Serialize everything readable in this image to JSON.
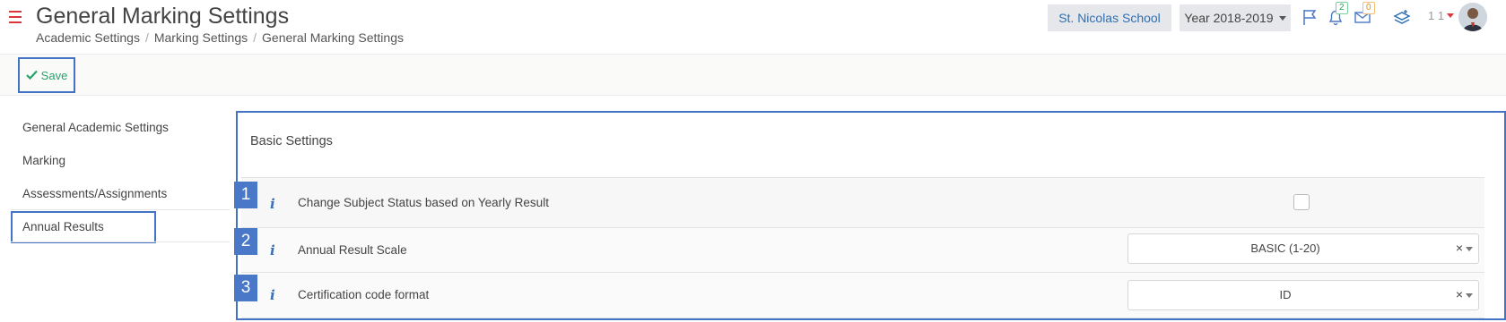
{
  "header": {
    "title": "General Marking Settings",
    "breadcrumb": [
      "Academic Settings",
      "Marking Settings",
      "General Marking Settings"
    ],
    "school": "St. Nicolas School",
    "year": "Year 2018-2019",
    "notifications_count": "2",
    "messages_count": "0",
    "user_label": "1 1"
  },
  "toolbar": {
    "save_label": "Save"
  },
  "sidebar": {
    "items": [
      {
        "label": "General Academic Settings"
      },
      {
        "label": "Marking"
      },
      {
        "label": "Assessments/Assignments"
      },
      {
        "label": "Annual Results"
      }
    ]
  },
  "panel": {
    "heading": "Basic Settings",
    "rows": [
      {
        "number": "1",
        "label": "Change Subject Status based on Yearly Result"
      },
      {
        "number": "2",
        "label": "Annual Result Scale",
        "value": "BASIC (1-20)"
      },
      {
        "number": "3",
        "label": "Certification code format",
        "value": "ID"
      }
    ]
  },
  "colors": {
    "accent_blue": "#4472c4",
    "save_green": "#27a36b",
    "menu_red": "#d9363e"
  }
}
